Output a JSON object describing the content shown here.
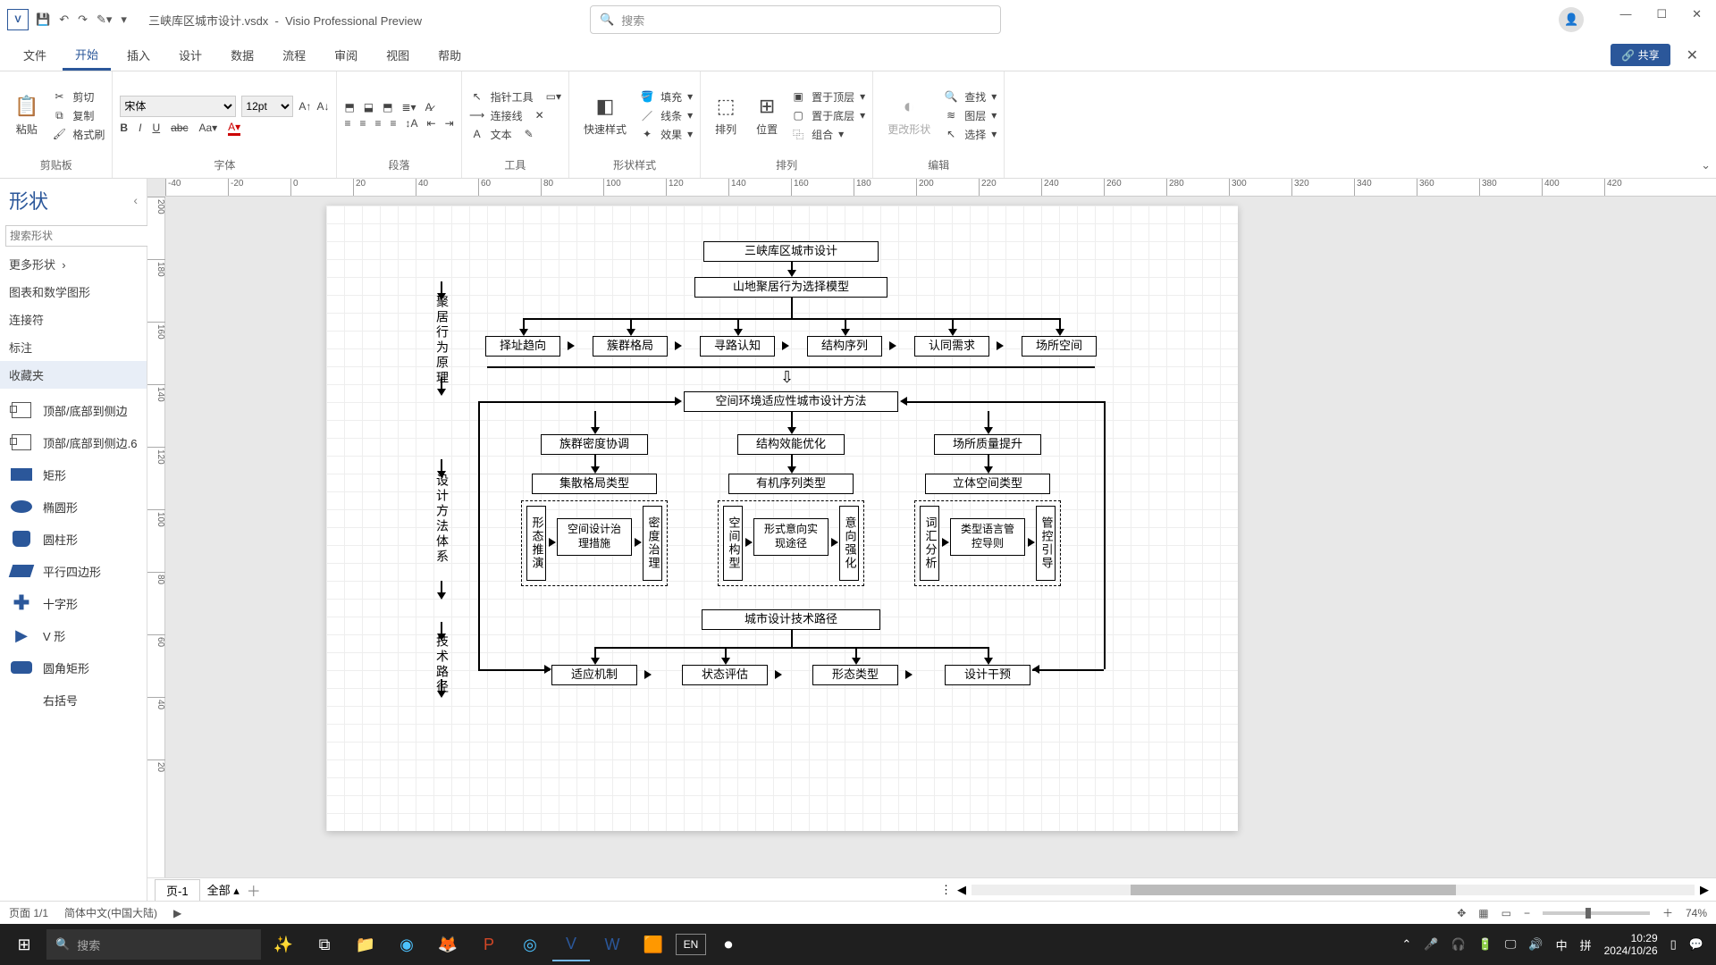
{
  "app": {
    "name": "V",
    "doc": "三峡库区城市设计.vsdx",
    "title_suffix": "Visio Professional Preview"
  },
  "search_placeholder": "搜索",
  "tabs": {
    "file": "文件",
    "home": "开始",
    "insert": "插入",
    "design": "设计",
    "data": "数据",
    "process": "流程",
    "review": "审阅",
    "view": "视图",
    "help": "帮助",
    "share": "共享"
  },
  "ribbon": {
    "clipboard": {
      "paste": "粘贴",
      "cut": "剪切",
      "copy": "复制",
      "fmt": "格式刷",
      "label": "剪贴板"
    },
    "font": {
      "family": "宋体",
      "size": "12pt",
      "label": "字体"
    },
    "para": {
      "label": "段落"
    },
    "tools": {
      "pointer": "指针工具",
      "connector": "连接线",
      "text": "文本",
      "label": "工具"
    },
    "shapestyle": {
      "quick": "快速样式",
      "fill": "填充",
      "line": "线条",
      "effect": "效果",
      "label": "形状样式"
    },
    "arrange": {
      "align": "排列",
      "position": "位置",
      "front": "置于顶层",
      "back": "置于底层",
      "group": "组合",
      "label": "排列"
    },
    "edit": {
      "change": "更改形状",
      "find": "查找",
      "layer": "图层",
      "select": "选择",
      "label": "编辑"
    }
  },
  "shapes_panel": {
    "title": "形状",
    "search_ph": "搜索形状",
    "cats": {
      "more": "更多形状",
      "charts": "图表和数学图形",
      "connectors": "连接符",
      "callouts": "标注",
      "favorites": "收藏夹"
    },
    "items": {
      "tb1": "顶部/底部到侧边",
      "tb2": "顶部/底部到侧边.6",
      "rect": "矩形",
      "ellipse": "椭圆形",
      "cyl": "圆柱形",
      "para": "平行四边形",
      "cross": "十字形",
      "v": "V 形",
      "round": "圆角矩形",
      "bracket": "右括号"
    }
  },
  "chart_data": {
    "type": "diagram",
    "title": "三峡库区城市设计",
    "sections": {
      "principle": {
        "label": "聚居行为原理",
        "root": "山地聚居行为选择模型",
        "items": [
          "择址趋向",
          "簇群格局",
          "寻路认知",
          "结构序列",
          "认同需求",
          "场所空间"
        ]
      },
      "methods": {
        "label": "设计方法体系",
        "hub": "空间环境适应性城市设计方法",
        "branches": [
          {
            "head": "族群密度协调",
            "type": "集散格局类型",
            "cells": [
              "形态推演",
              "空间设计治理措施",
              "密度治理"
            ]
          },
          {
            "head": "结构效能优化",
            "type": "有机序列类型",
            "cells": [
              "空间构型",
              "形式意向实现途径",
              "意向强化"
            ]
          },
          {
            "head": "场所质量提升",
            "type": "立体空间类型",
            "cells": [
              "词汇分析",
              "类型语言管控导则",
              "管控引导"
            ]
          }
        ]
      },
      "path": {
        "label": "技术路径",
        "hub": "城市设计技术路径",
        "items": [
          "适应机制",
          "状态评估",
          "形态类型",
          "设计干预"
        ]
      }
    }
  },
  "hruler_ticks": [
    "-40",
    "-20",
    "0",
    "20",
    "40",
    "60",
    "80",
    "100",
    "120",
    "140",
    "160",
    "180",
    "200",
    "220",
    "240",
    "260",
    "280",
    "300",
    "320",
    "340",
    "360",
    "380",
    "400",
    "420"
  ],
  "vruler_ticks": [
    "200",
    "180",
    "160",
    "140",
    "120",
    "100",
    "80",
    "60",
    "40",
    "20"
  ],
  "page_tabs": {
    "p1": "页-1",
    "all": "全部"
  },
  "status": {
    "page": "页面 1/1",
    "lang": "简体中文(中国大陆)",
    "zoom": "74%"
  },
  "taskbar": {
    "search": "搜索",
    "ime": "中",
    "ime2": "拼",
    "en": "EN",
    "time": "10:29",
    "date": "2024/10/26"
  }
}
